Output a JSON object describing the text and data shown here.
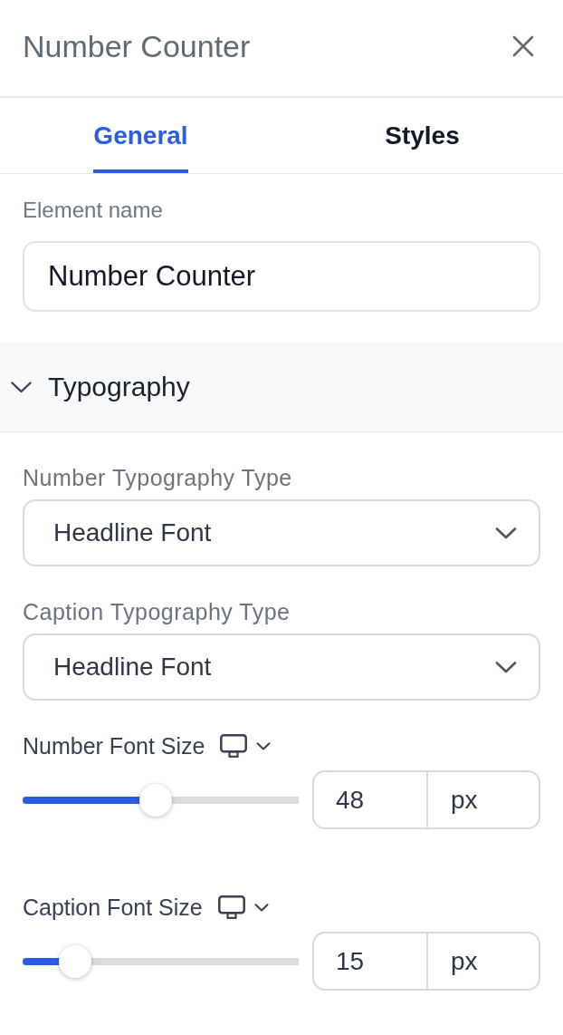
{
  "panel": {
    "title": "Number Counter"
  },
  "tabs": [
    {
      "label": "General",
      "selected": true
    },
    {
      "label": "Styles",
      "selected": false
    }
  ],
  "element_name": {
    "label": "Element name",
    "value": "Number Counter"
  },
  "sections": [
    {
      "title": "Typography",
      "expanded": true,
      "controls": [
        {
          "kind": "select",
          "label": "Number Typography Type",
          "value": "Headline Font"
        },
        {
          "kind": "select",
          "label": "Caption Typography Type",
          "value": "Headline Font"
        },
        {
          "kind": "slider",
          "label": "Number Font Size",
          "level": 0.48,
          "value": "48",
          "unit": "px"
        },
        {
          "kind": "slider",
          "label": "Caption Font Size",
          "level": 0.15,
          "value": "15",
          "unit": "px"
        }
      ]
    }
  ]
}
